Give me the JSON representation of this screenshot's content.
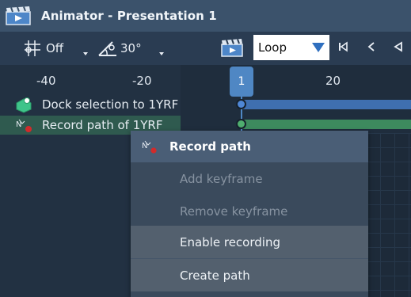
{
  "window": {
    "title": "Animator - Presentation 1",
    "app_icon": "clapperboard-icon"
  },
  "toolbar": {
    "snap_grid_label": "Off",
    "snap_grid_icon": "grid-snap-icon",
    "angle_label": "30°",
    "angle_icon": "angle-snap-icon",
    "clapper_icon": "clapperboard-icon",
    "loop_mode": "Loop",
    "nav_icons": [
      "skip-to-start-icon",
      "step-back-icon",
      "play-reverse-icon"
    ]
  },
  "ruler": {
    "ticks": [
      "-40",
      "-20",
      "20"
    ],
    "playhead_label": "1"
  },
  "tracks": [
    {
      "label": "Dock selection to 1YRF",
      "icon": "dock-icon",
      "bar_color": "#3f6fb0",
      "knob_color": "#4f87d6",
      "selected": false
    },
    {
      "label": "Record path of 1YRF",
      "icon": "record-path-icon",
      "bar_color": "#3d8a5e",
      "knob_color": "#4fae6f",
      "selected": true
    }
  ],
  "context_menu": {
    "header": "Record path",
    "header_icon": "record-path-icon",
    "items": [
      {
        "label": "Add keyframe",
        "enabled": false
      },
      {
        "label": "Remove keyframe",
        "enabled": false
      },
      {
        "label": "Enable recording",
        "enabled": true
      },
      {
        "label": "Create path",
        "enabled": true
      }
    ]
  },
  "colors": {
    "accent": "#4f87c4",
    "selection": "#2f5a4f",
    "titlebar": "#3b526b"
  }
}
